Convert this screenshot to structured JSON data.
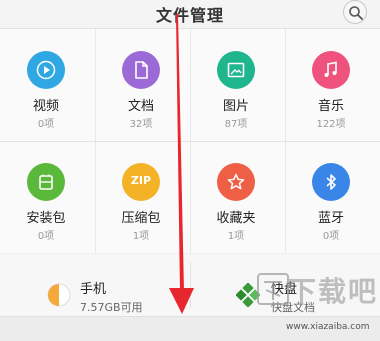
{
  "header": {
    "title": "文件管理"
  },
  "categories": [
    {
      "label": "视频",
      "count": "0项",
      "icon": "video-icon",
      "color": "#2fa7e3"
    },
    {
      "label": "文档",
      "count": "32项",
      "icon": "document-icon",
      "color": "#9b6ad6"
    },
    {
      "label": "图片",
      "count": "87项",
      "icon": "image-icon",
      "color": "#1fb58d"
    },
    {
      "label": "音乐",
      "count": "122项",
      "icon": "music-icon",
      "color": "#f0527e"
    },
    {
      "label": "安装包",
      "count": "0项",
      "icon": "package-icon",
      "color": "#5ab83a"
    },
    {
      "label": "压缩包",
      "count": "1项",
      "icon": "zip-icon",
      "color": "#f4b226"
    },
    {
      "label": "收藏夹",
      "count": "1项",
      "icon": "star-icon",
      "color": "#ee5f45"
    },
    {
      "label": "蓝牙",
      "count": "0项",
      "icon": "bluetooth-icon",
      "color": "#3a86e8"
    }
  ],
  "zip_text": "ZIP",
  "storage": {
    "phone": {
      "name": "手机",
      "sub": "7.57GB可用",
      "used_fraction": 0.5
    },
    "kuaipan": {
      "name": "快盘",
      "sub": "快盘文档"
    }
  },
  "watermark": {
    "text": "下载吧",
    "url": "www.xiazaiba.com"
  },
  "colors": {
    "arrow": "#e8262e",
    "phone_pie": "#f6a93b"
  }
}
